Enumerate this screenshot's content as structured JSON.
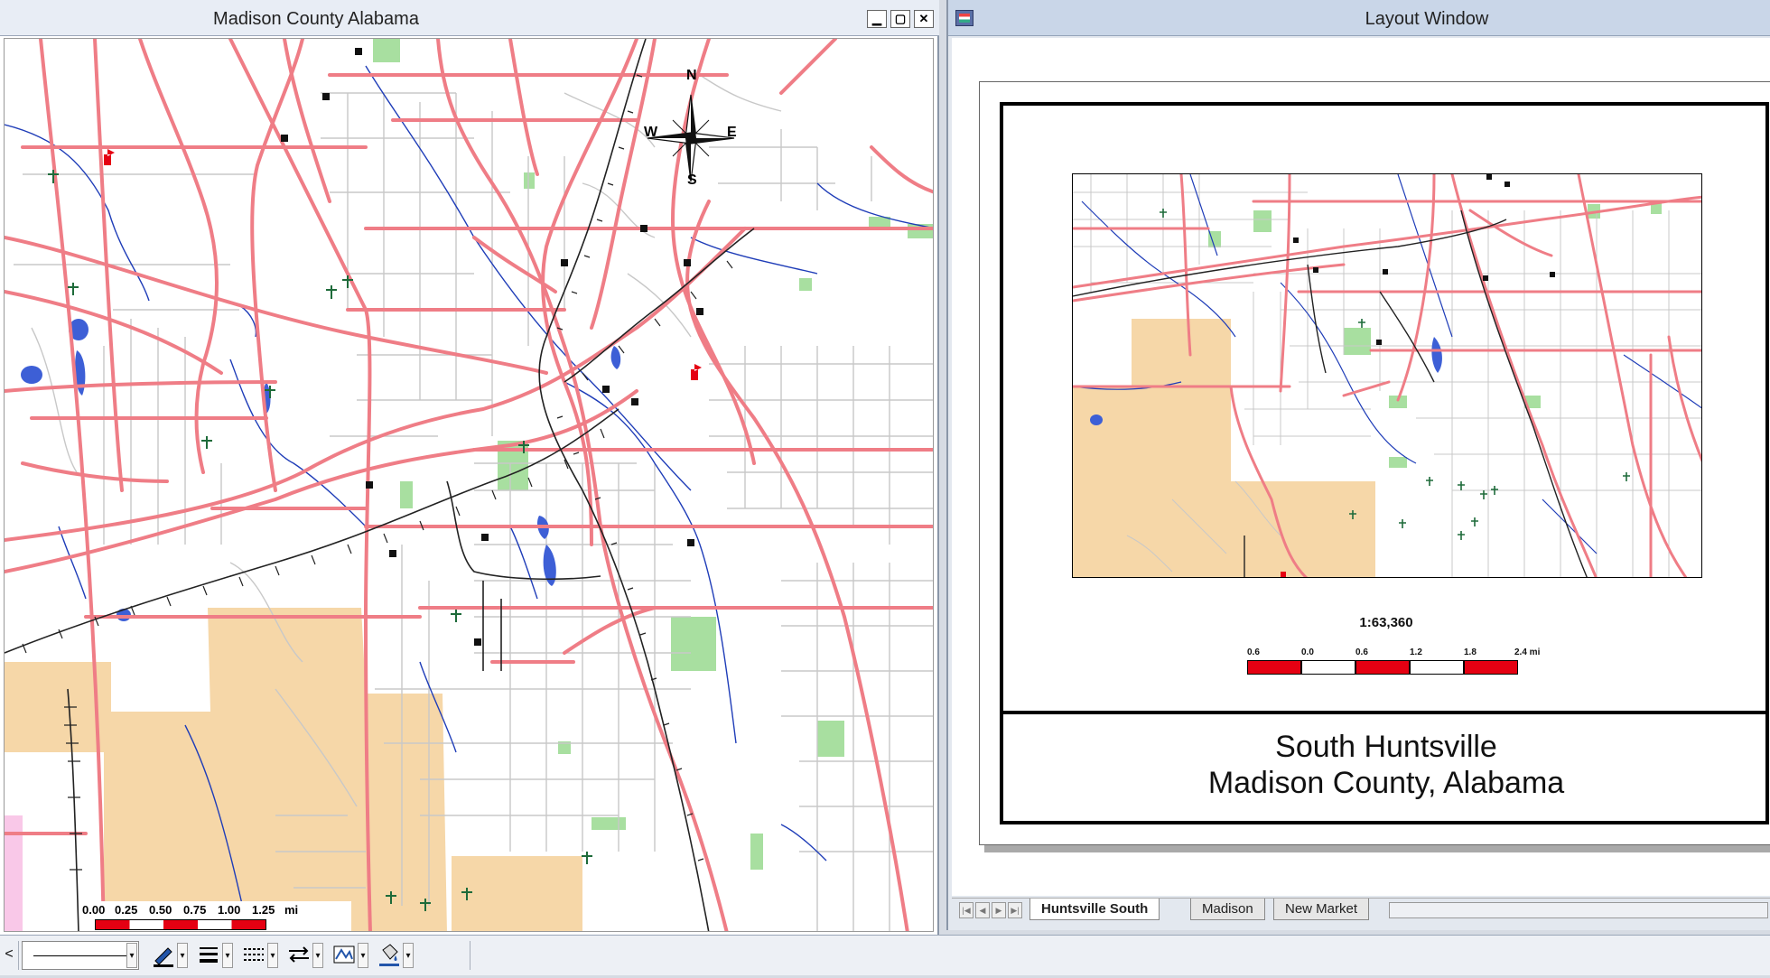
{
  "map_window": {
    "title": "Madison County Alabama",
    "buttons": {
      "minimize": "▁",
      "maximize": "▢",
      "close": "✕"
    },
    "compass": {
      "n": "N",
      "s": "S",
      "e": "E",
      "w": "W"
    },
    "scale_bar": {
      "labels": [
        "0.00",
        "0.25",
        "0.50",
        "0.75",
        "1.00",
        "1.25"
      ],
      "unit": "mi"
    }
  },
  "layout_window": {
    "title": "Layout Window",
    "scale_ratio": "1:63,360",
    "scale_bar": {
      "labels": [
        "0.6",
        "0.0",
        "0.6",
        "1.2",
        "1.8",
        "2.4 mi"
      ]
    },
    "heading_line1": "South Huntsville",
    "heading_line2": "Madison County, Alabama",
    "tabs": [
      {
        "label": "Huntsville South",
        "active": true
      },
      {
        "label": "Madison",
        "active": false
      },
      {
        "label": "New Market",
        "active": false
      }
    ],
    "tab_nav": [
      "|◀",
      "◀",
      "▶",
      "▶|"
    ]
  },
  "toolbar": {
    "left_arrow": "<",
    "icons": [
      "pen-color-icon",
      "line-width-icon",
      "line-pattern-icon",
      "arrow-style-icon",
      "fill-icon",
      "fill-color-icon"
    ]
  },
  "colors": {
    "road": "#ef7d86",
    "street": "#c8c8c8",
    "water": "#1f3db8",
    "park": "#a8dfa0",
    "landuse": "#f6d7a8",
    "rail": "#222222",
    "scale_red": "#e50012"
  }
}
